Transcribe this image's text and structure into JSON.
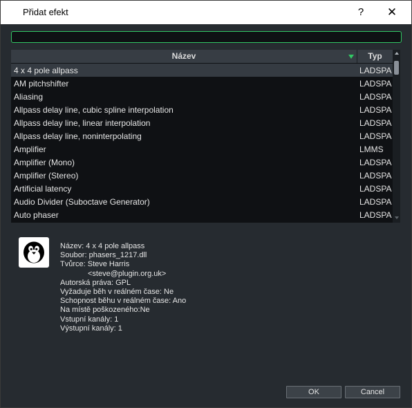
{
  "dialog": {
    "title": "Přidat efekt",
    "help_glyph": "?",
    "close_glyph": "✕"
  },
  "search": {
    "value": "",
    "placeholder": ""
  },
  "table": {
    "headers": {
      "name": "Název",
      "type": "Typ"
    },
    "sort_column": "name",
    "rows": [
      {
        "name": "4 x 4 pole allpass",
        "type": "LADSPA",
        "selected": true
      },
      {
        "name": "AM pitchshifter",
        "type": "LADSPA"
      },
      {
        "name": "Aliasing",
        "type": "LADSPA"
      },
      {
        "name": "Allpass delay line, cubic spline interpolation",
        "type": "LADSPA"
      },
      {
        "name": "Allpass delay line, linear interpolation",
        "type": "LADSPA"
      },
      {
        "name": "Allpass delay line, noninterpolating",
        "type": "LADSPA"
      },
      {
        "name": "Amplifier",
        "type": "LMMS"
      },
      {
        "name": "Amplifier (Mono)",
        "type": "LADSPA"
      },
      {
        "name": "Amplifier (Stereo)",
        "type": "LADSPA"
      },
      {
        "name": "Artificial latency",
        "type": "LADSPA"
      },
      {
        "name": "Audio Divider (Suboctave Generator)",
        "type": "LADSPA"
      },
      {
        "name": "Auto phaser",
        "type": "LADSPA"
      }
    ]
  },
  "details": {
    "icon": "tux-penguin-icon",
    "lines": [
      "Název: 4 x 4 pole allpass",
      "Soubor: phasers_1217.dll",
      "Tvůrce: Steve Harris",
      "<steve@plugin.org.uk>",
      "Autorská práva: GPL",
      "Vyžaduje běh v reálném čase: Ne",
      "Schopnost běhu v reálném čase: Ano",
      "Na místě poškozeného:Ne",
      "Vstupní kanály: 1",
      "Výstupní kanály: 1"
    ]
  },
  "buttons": {
    "ok": "OK",
    "cancel": "Cancel"
  },
  "colors": {
    "accent": "#32c864",
    "background": "#262b30",
    "list_background": "#0f1114",
    "selected_row": "#353b42"
  }
}
